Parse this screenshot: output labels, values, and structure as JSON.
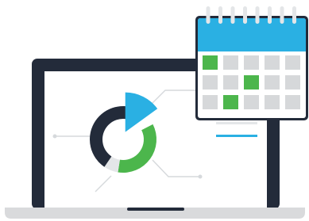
{
  "colors": {
    "laptop_frame": "#232b3a",
    "screen": "#ffffff",
    "laptop_base": "#d9dadc",
    "laptop_base_shadow": "#c4c6c9",
    "connector_lines": "#d6d9dc",
    "donut_segments": [
      {
        "name": "dark",
        "color": "#232b3a",
        "fraction": 0.47
      },
      {
        "name": "green",
        "color": "#4cb64c",
        "fraction": 0.35
      },
      {
        "name": "light",
        "color": "#e4e6e8",
        "fraction": 0.07
      }
    ],
    "donut_slice_exploded": "#2ab0e3",
    "calendar_header": "#2ab0e3",
    "calendar_border": "#232b3a",
    "calendar_rings": "#e4e6e8",
    "calendar_cell_default": "#d6d8da",
    "calendar_cell_highlight": "#4cb64c",
    "bar_light": "#e4e6e8",
    "bar_blue": "#2ab0e3"
  },
  "calendar": {
    "rings": 8,
    "rows": 3,
    "cols": 5,
    "highlighted_cells": [
      [
        0,
        0
      ],
      [
        1,
        2
      ],
      [
        2,
        1
      ]
    ]
  },
  "icons": {
    "illustration": "laptop-with-donut-chart-and-calendar"
  }
}
